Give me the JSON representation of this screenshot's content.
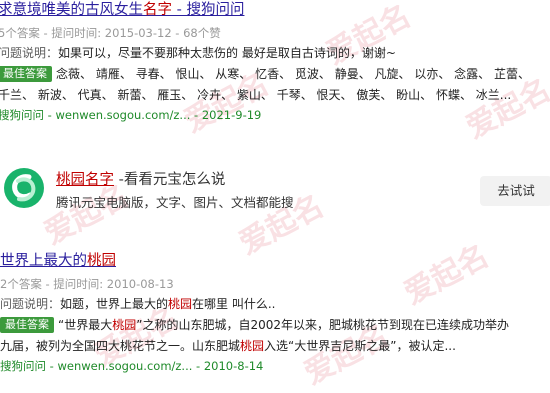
{
  "result1": {
    "title_pre": "求意境唯美的古风女生",
    "title_hl": "名字",
    "title_post": " - 搜狗问问",
    "meta": "5个答案 - 提问时间: 2015-03-12 - 68个赞",
    "question_label": "问题说明：",
    "question_text": "如果可以，尽量不要那种太悲伤的 最好是取自古诗词的，谢谢~",
    "best_label": "最佳答案",
    "answer_line1": "念薇、 靖雁、 寻春、 恨山、 从寒、 忆香、 觅波、 静曼、 凡旋、 以亦、 念露、 芷蕾、",
    "answer_line2": "千兰、 新波、 代真、 新蕾、 雁玉、 冷卉、 紫山、 千琴、 恨天、 傲芙、 盼山、 怀蝶、  冰兰...",
    "source": "搜狗问问 - wenwen.sogou.com/z... - 2021-9-19"
  },
  "ad": {
    "title_link": "桃园名字",
    "title_rest": " -看看元宝怎么说",
    "desc": "腾讯元宝电脑版，文字、图片、文档都能搜",
    "button": "去试试",
    "logo_icon": "yuanbao-logo-icon"
  },
  "result2": {
    "title_pre": "世界上最大的",
    "title_hl": "桃园",
    "meta": "2个答案 - 提问时间: 2010-08-13",
    "question_label": "问题说明：",
    "question_pre": "如题，世界上最大的",
    "question_hl": "桃园",
    "question_post": "在哪里 叫什么..",
    "best_label": "最佳答案",
    "answer_line1_pre": "“世界最大",
    "answer_line1_hl": "桃园",
    "answer_line1_post": "”之称的山东肥城，自2002年以来，肥城桃花节到现在已连续成功举办",
    "answer_line2_pre": "九届，被列为全国四大桃花节之一。山东肥城",
    "answer_line2_hl": "桃园",
    "answer_line2_post": "入选“大世界吉尼斯之最”，被认定...",
    "source": "搜狗问问 - wenwen.sogou.com/z... - 2010-8-14"
  },
  "watermark": "爱起名"
}
